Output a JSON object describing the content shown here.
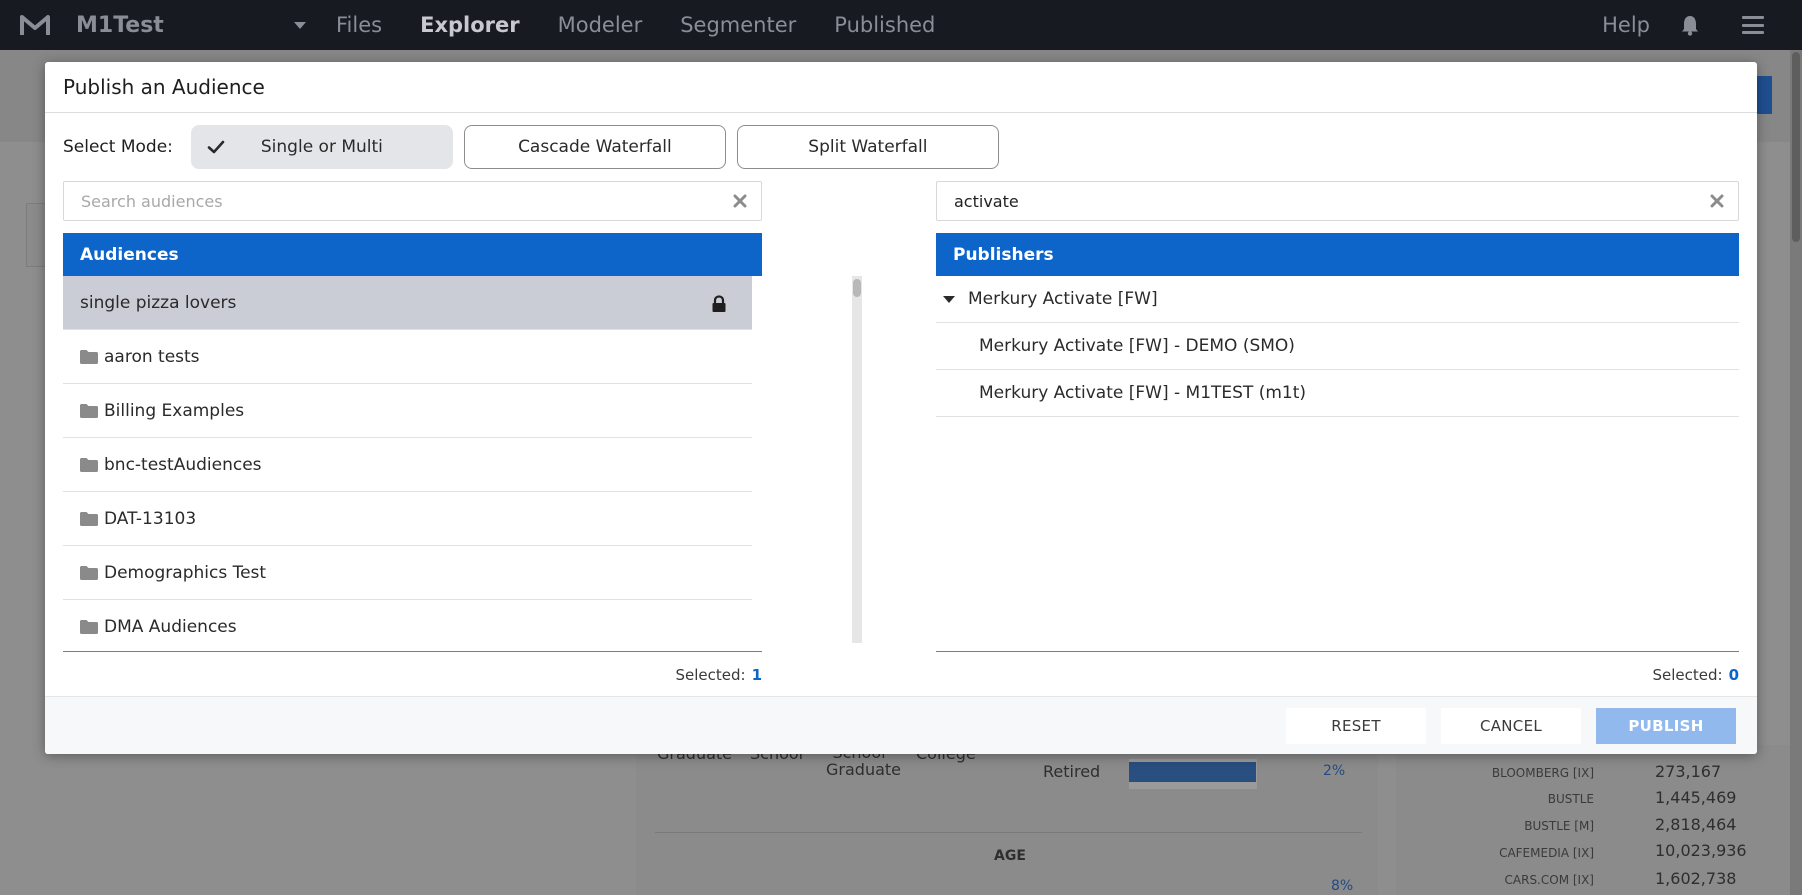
{
  "nav": {
    "org": "M1Test",
    "links": [
      "Files",
      "Explorer",
      "Modeler",
      "Segmenter",
      "Published"
    ],
    "active": "Explorer",
    "help": "Help"
  },
  "background": {
    "edu_labels": [
      "Graduate",
      "School",
      "School Graduate",
      "College"
    ],
    "retired": "Retired",
    "retired_pct": "2%",
    "age_heading": "AGE",
    "age_pct": "8%",
    "publishers": [
      {
        "name": "BLOOMBERG [IX]",
        "value": "273,167"
      },
      {
        "name": "BUSTLE",
        "value": "1,445,469"
      },
      {
        "name": "BUSTLE [M]",
        "value": "2,818,464"
      },
      {
        "name": "CAFEMEDIA [IX]",
        "value": "10,023,936"
      },
      {
        "name": "CARS.COM [IX]",
        "value": "1,602,738"
      }
    ]
  },
  "modal": {
    "title": "Publish an Audience",
    "mode_label": "Select Mode:",
    "modes": [
      {
        "label": "Single or Multi",
        "selected": true
      },
      {
        "label": "Cascade Waterfall",
        "selected": false
      },
      {
        "label": "Split Waterfall",
        "selected": false
      }
    ],
    "left": {
      "search_placeholder": "Search audiences",
      "search_value": "",
      "header": "Audiences",
      "items": [
        {
          "label": "single pizza lovers",
          "type": "audience",
          "selected": true,
          "locked": true
        },
        {
          "label": "aaron tests",
          "type": "folder"
        },
        {
          "label": "Billing Examples",
          "type": "folder"
        },
        {
          "label": "bnc-testAudiences",
          "type": "folder"
        },
        {
          "label": "DAT-13103",
          "type": "folder"
        },
        {
          "label": "Demographics Test",
          "type": "folder"
        },
        {
          "label": "DMA Audiences",
          "type": "folder"
        }
      ],
      "selected_label": "Selected:",
      "selected_count": "1"
    },
    "right": {
      "search_placeholder": "",
      "search_value": "activate",
      "header": "Publishers",
      "parent": "Merkury Activate [FW]",
      "children": [
        "Merkury Activate [FW] - DEMO (SMO)",
        "Merkury Activate [FW] - M1TEST (m1t)"
      ],
      "selected_label": "Selected:",
      "selected_count": "0"
    },
    "buttons": {
      "reset": "RESET",
      "cancel": "CANCEL",
      "publish": "PUBLISH"
    }
  },
  "colors": {
    "nav_bg": "#181a22",
    "accent": "#0d64c9",
    "publish_disabled": "#92b9ee",
    "selected_row": "#cbcdd6"
  }
}
